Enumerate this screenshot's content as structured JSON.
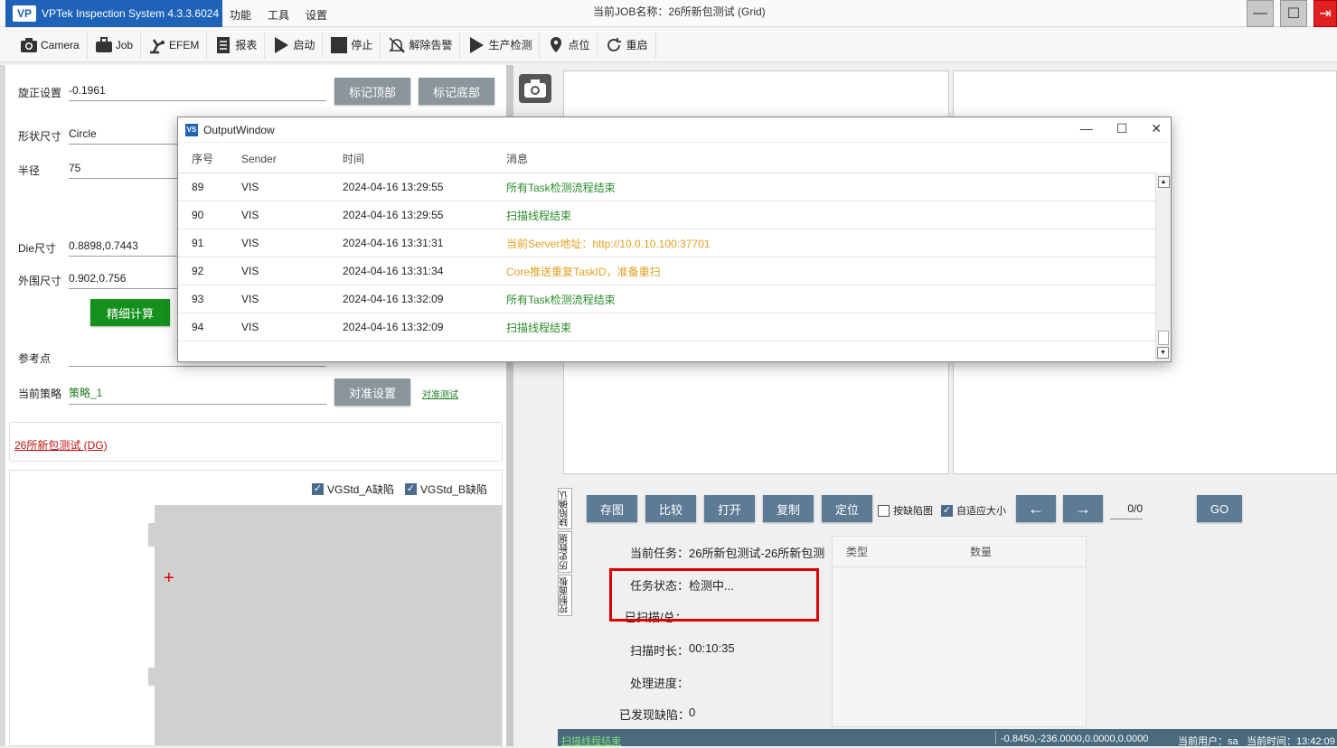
{
  "app": {
    "title": "VPTek Inspection System 4.3.3.6024",
    "logo": "VP",
    "menu": [
      "功能",
      "工具",
      "设置"
    ],
    "job_title": "当前JOB名称：26所新包测试 (Grid)",
    "window_buttons": [
      "minimize-icon",
      "maximize-icon",
      "exit-icon"
    ]
  },
  "toolbar": [
    {
      "label": "Camera",
      "icon": "camera-icon"
    },
    {
      "label": "Job",
      "icon": "briefcase-icon"
    },
    {
      "label": "EFEM",
      "icon": "robot-arm-icon"
    },
    {
      "label": "报表",
      "icon": "report-icon"
    },
    {
      "label": "启动",
      "icon": "play-icon"
    },
    {
      "label": "停止",
      "icon": "stop-icon"
    },
    {
      "label": "解除告警",
      "icon": "bell-off-icon"
    },
    {
      "label": "生产检测",
      "icon": "play-icon"
    },
    {
      "label": "点位",
      "icon": "location-pin-icon"
    },
    {
      "label": "重启",
      "icon": "restart-icon"
    }
  ],
  "left_panel": {
    "rotation_label": "旋正设置",
    "rotation_value": "-0.1961",
    "mark_top_button": "标记顶部",
    "mark_bottom_button": "标记底部",
    "shape_label": "形状尺寸",
    "shape_value": "Circle",
    "radius_label": "半径",
    "radius_value": "75",
    "die_label": "Die尺寸",
    "die_value": "0.8898,0.7443",
    "outer_label": "外围尺寸",
    "outer_value": "0.902,0.756",
    "fine_calc_button": "精细计算",
    "ref_point_label": "参考点",
    "strategy_label": "当前策略",
    "strategy_value": "策略_1",
    "align_button": "对准设置",
    "align_test_link": "对准测试",
    "job_link": "26所新包测试 (DG)",
    "checkbox_a": {
      "label": "VGStd_A缺陷",
      "checked": true
    },
    "checkbox_b": {
      "label": "VGStd_B缺陷",
      "checked": true
    },
    "crosshair": "+"
  },
  "right": {
    "vertical_tabs": [
      "缺陷确认",
      "历史数据",
      "控制面板"
    ],
    "buttons": [
      "存图",
      "比较",
      "打开",
      "复制",
      "定位"
    ],
    "by_defect_check": {
      "label": "按缺陷图",
      "checked": false
    },
    "auto_size_check": {
      "label": "自适应大小",
      "checked": true
    },
    "prev_arrow": "←",
    "next_arrow": "→",
    "page_counter": "0/0",
    "go_button": "GO",
    "current_task_label": "当前任务：",
    "current_task_value": "26所新包测试-26所新包测",
    "task_status_label": "任务状态：",
    "task_status_value": "检测中...",
    "scanned_label": "已扫描/总：",
    "scan_duration_label": "扫描时长：",
    "scan_duration_value": "00:10:35",
    "progress_label": "处理进度：",
    "found_defects_label": "已发现缺陷：",
    "found_defects_value": "0",
    "table_headers": [
      "类型",
      "数量"
    ]
  },
  "status_bar": {
    "left": "扫描线程结束",
    "coords": "-0.8450,-236.0000,0.0000,0.0000",
    "user": "当前用户：sa",
    "time": "当前时间：13:42:09"
  },
  "output_window": {
    "title": "OutputWindow",
    "headers": [
      "序号",
      "Sender",
      "时间",
      "消息"
    ],
    "rows": [
      {
        "seq": "89",
        "sender": "VIS",
        "time": "2024-04-16 13:29:55",
        "msg": "所有Task检测流程结束",
        "color": "#2a8a2a"
      },
      {
        "seq": "90",
        "sender": "VIS",
        "time": "2024-04-16 13:29:55",
        "msg": "扫描线程结束",
        "color": "#2a8a2a"
      },
      {
        "seq": "91",
        "sender": "VIS",
        "time": "2024-04-16 13:31:31",
        "msg": "当前Server地址：http://10.0.10.100:37701",
        "color": "#e0a020"
      },
      {
        "seq": "92",
        "sender": "VIS",
        "time": "2024-04-16 13:31:34",
        "msg": "Core推送重复TaskID，准备重扫",
        "color": "#e0a020"
      },
      {
        "seq": "93",
        "sender": "VIS",
        "time": "2024-04-16 13:32:09",
        "msg": "所有Task检测流程结束",
        "color": "#2a8a2a"
      },
      {
        "seq": "94",
        "sender": "VIS",
        "time": "2024-04-16 13:32:09",
        "msg": "扫描线程结束",
        "color": "#2a8a2a"
      }
    ]
  }
}
